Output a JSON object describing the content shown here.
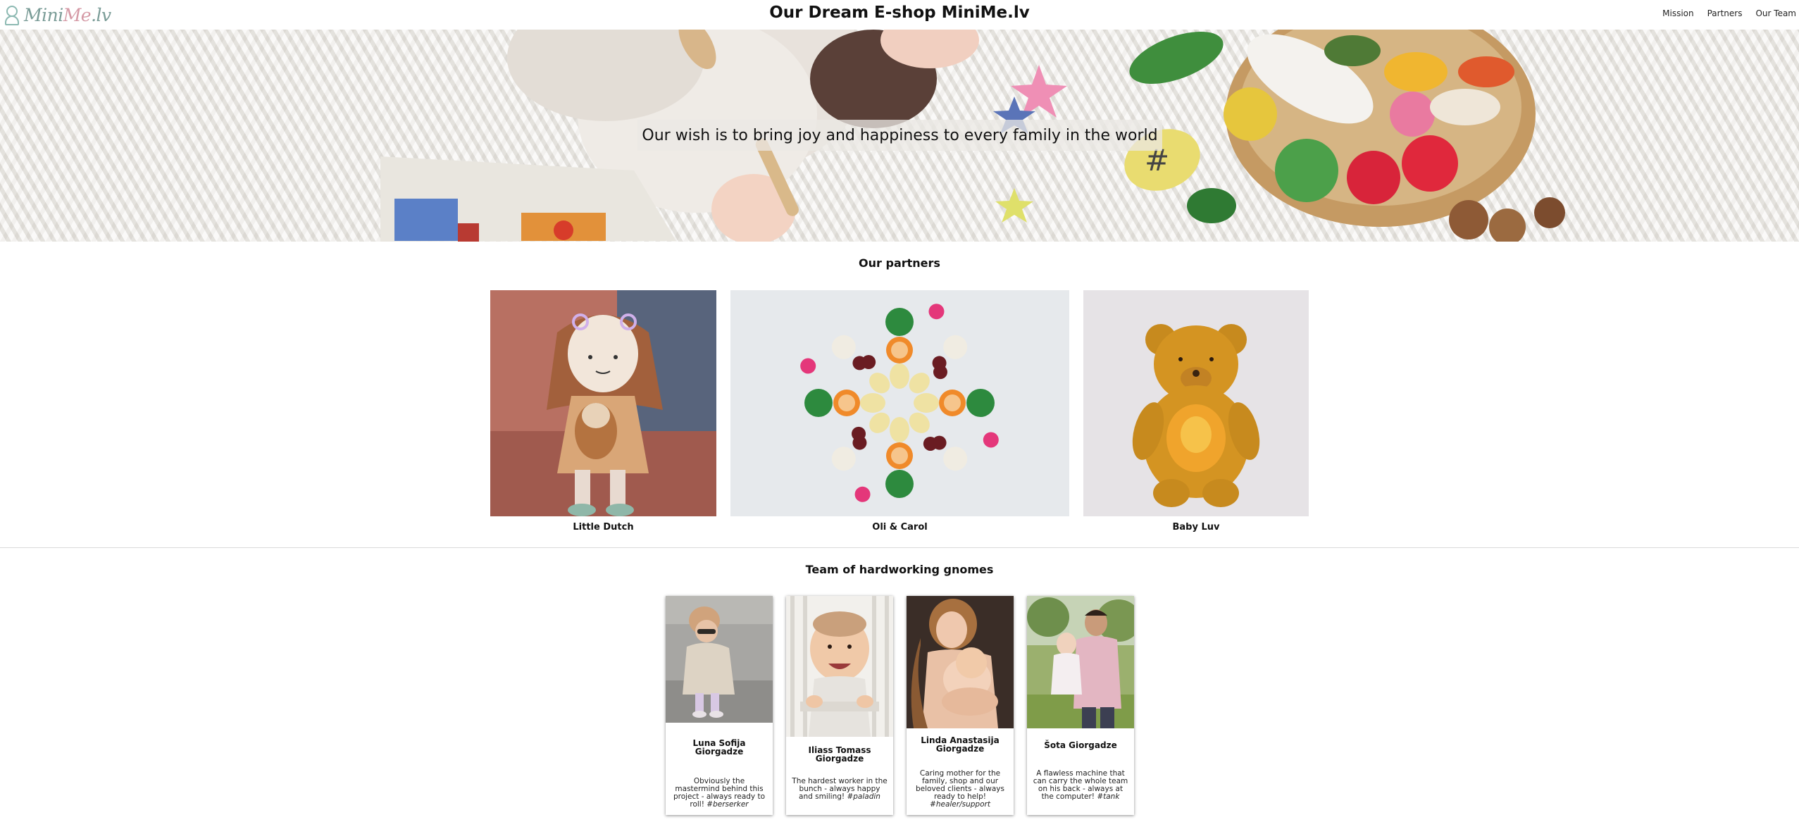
{
  "header": {
    "logo": {
      "part1": "Mini",
      "part2": "Me",
      "part3": ".lv"
    },
    "title": "Our Dream E-shop MiniMe.lv",
    "nav": [
      "Mission",
      "Partners",
      "Our Team"
    ]
  },
  "hero": {
    "caption": "Our wish is to bring joy and happiness to every family in the world"
  },
  "partners": {
    "title": "Our partners",
    "items": [
      {
        "name": "Little Dutch"
      },
      {
        "name": "Oli & Carol"
      },
      {
        "name": "Baby Luv"
      }
    ]
  },
  "team": {
    "title": "Team of hardworking gnomes",
    "members": [
      {
        "name": "Luna Sofija Giorgadze",
        "desc": "Obviously the mastermind behind this project - always ready to roll!",
        "tag": "#berserker"
      },
      {
        "name": "Iliass Tomass Giorgadze",
        "desc": "The hardest worker in the bunch - always happy and smiling!",
        "tag": "#paladin"
      },
      {
        "name": "Linda Anastasija Giorgadze",
        "desc": "Caring mother for the family, shop and our beloved clients - always ready to help!",
        "tag": "#healer/support"
      },
      {
        "name": "Šota Giorgadze",
        "desc": "A flawless machine that can carry the whole team on his back - always at the computer!",
        "tag": "#tank"
      }
    ]
  },
  "colors": {
    "logo_teal": "#7a9c97",
    "logo_pink": "#d59aa6",
    "divider": "#dadada"
  }
}
